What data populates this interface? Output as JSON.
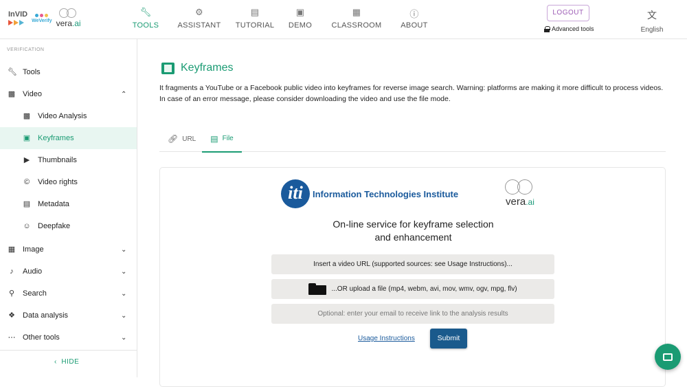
{
  "header": {
    "logos": {
      "invid": "InVID",
      "weverify": "WeVerify",
      "vera": "vera",
      "vera_ai": ".ai"
    },
    "nav": [
      {
        "label": "TOOLS",
        "icon": "wrench-icon",
        "active": true
      },
      {
        "label": "ASSISTANT",
        "icon": "robot-icon",
        "active": false
      },
      {
        "label": "TUTORIAL",
        "icon": "book-icon",
        "active": false
      },
      {
        "label": "DEMO",
        "icon": "video-icon",
        "active": false
      },
      {
        "label": "CLASSROOM",
        "icon": "classroom-icon",
        "active": false
      },
      {
        "label": "ABOUT",
        "icon": "info-icon",
        "active": false
      }
    ],
    "logout_label": "LOGOUT",
    "advanced_tools_label": "Advanced tools",
    "language_label": "English"
  },
  "sidebar": {
    "section_label": "VERIFICATION",
    "items": [
      {
        "label": "Tools",
        "icon": "wrench-icon"
      },
      {
        "label": "Video",
        "icon": "film-icon",
        "expanded": true
      },
      {
        "label": "Video Analysis",
        "icon": "video-analysis-icon"
      },
      {
        "label": "Keyframes",
        "icon": "keyframes-icon",
        "active": true
      },
      {
        "label": "Thumbnails",
        "icon": "youtube-icon"
      },
      {
        "label": "Video rights",
        "icon": "copyright-icon"
      },
      {
        "label": "Metadata",
        "icon": "document-icon"
      },
      {
        "label": "Deepfake",
        "icon": "face-scan-icon"
      },
      {
        "label": "Image",
        "icon": "image-icon"
      },
      {
        "label": "Audio",
        "icon": "music-note-icon"
      },
      {
        "label": "Search",
        "icon": "search-icon"
      },
      {
        "label": "Data analysis",
        "icon": "data-analysis-icon"
      },
      {
        "label": "Other tools",
        "icon": "more-icon"
      }
    ],
    "hide_label": "HIDE"
  },
  "main": {
    "title": "Keyframes",
    "description": "It fragments a YouTube or a Facebook public video into keyframes for reverse image search. Warning: platforms are making it more difficult to process videos. In case of an error message, please consider downloading the video and use the file mode.",
    "tabs": [
      {
        "label": "URL",
        "icon": "link-icon",
        "active": false
      },
      {
        "label": "File",
        "icon": "file-upload-icon",
        "active": true
      }
    ],
    "card": {
      "iti_letters": "iti",
      "iti_name": "Information Technologies Institute",
      "vera_name": "vera",
      "vera_ai": ".ai",
      "service_title_line1": "On-line service for keyframe selection",
      "service_title_line2": "and enhancement",
      "url_field": "Insert a video URL (supported sources: see Usage Instructions)...",
      "upload_field": "...OR upload a file (mp4, webm, avi, mov, wmv, ogv, mpg, flv)",
      "email_placeholder": "Optional: enter your email to receive link to the analysis results",
      "usage_link": "Usage Instructions",
      "submit_label": "Submit"
    }
  },
  "colors": {
    "accent": "#1a9b73",
    "logout": "#9c5bb5",
    "submit": "#1a5a8c"
  }
}
